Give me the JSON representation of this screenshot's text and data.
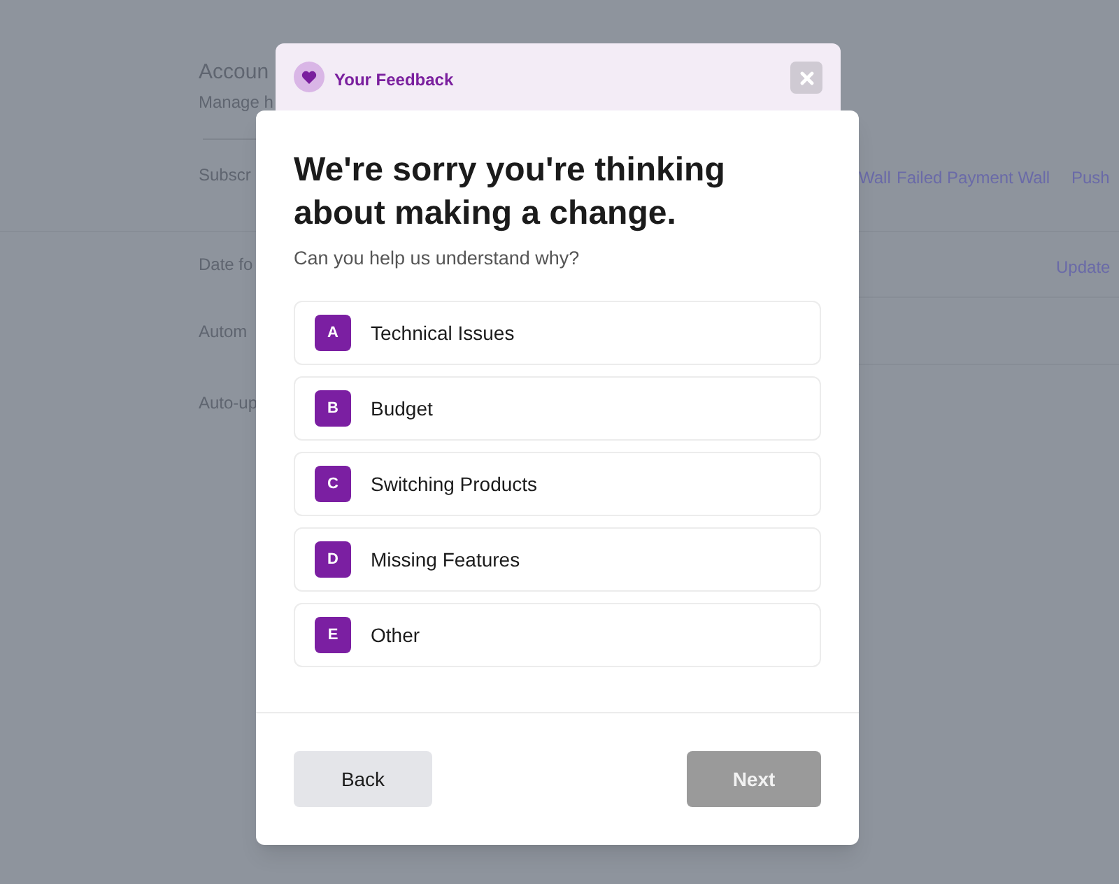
{
  "background_page": {
    "title": "Accoun",
    "subtitle": "Manage h",
    "tabs_label": "Subscr",
    "tabs": [
      "Wall",
      "Failed Payment Wall",
      "Push"
    ],
    "rows": [
      {
        "label": "Date fo",
        "action": "Update"
      },
      {
        "label": "Autom"
      },
      {
        "label": "Auto-up"
      }
    ]
  },
  "dialog": {
    "header": {
      "title": "Your Feedback"
    },
    "heading": "We're sorry you're thinking about making a change.",
    "subheading": "Can you help us understand why?",
    "options": [
      {
        "key": "A",
        "label": "Technical Issues",
        "selected": false
      },
      {
        "key": "B",
        "label": "Budget",
        "selected": false
      },
      {
        "key": "C",
        "label": "Switching Products",
        "selected": false
      },
      {
        "key": "D",
        "label": "Missing Features",
        "selected": false
      },
      {
        "key": "E",
        "label": "Other",
        "selected": false
      }
    ],
    "back_button": "Back",
    "next_button": {
      "label": "Next",
      "disabled": true
    }
  }
}
